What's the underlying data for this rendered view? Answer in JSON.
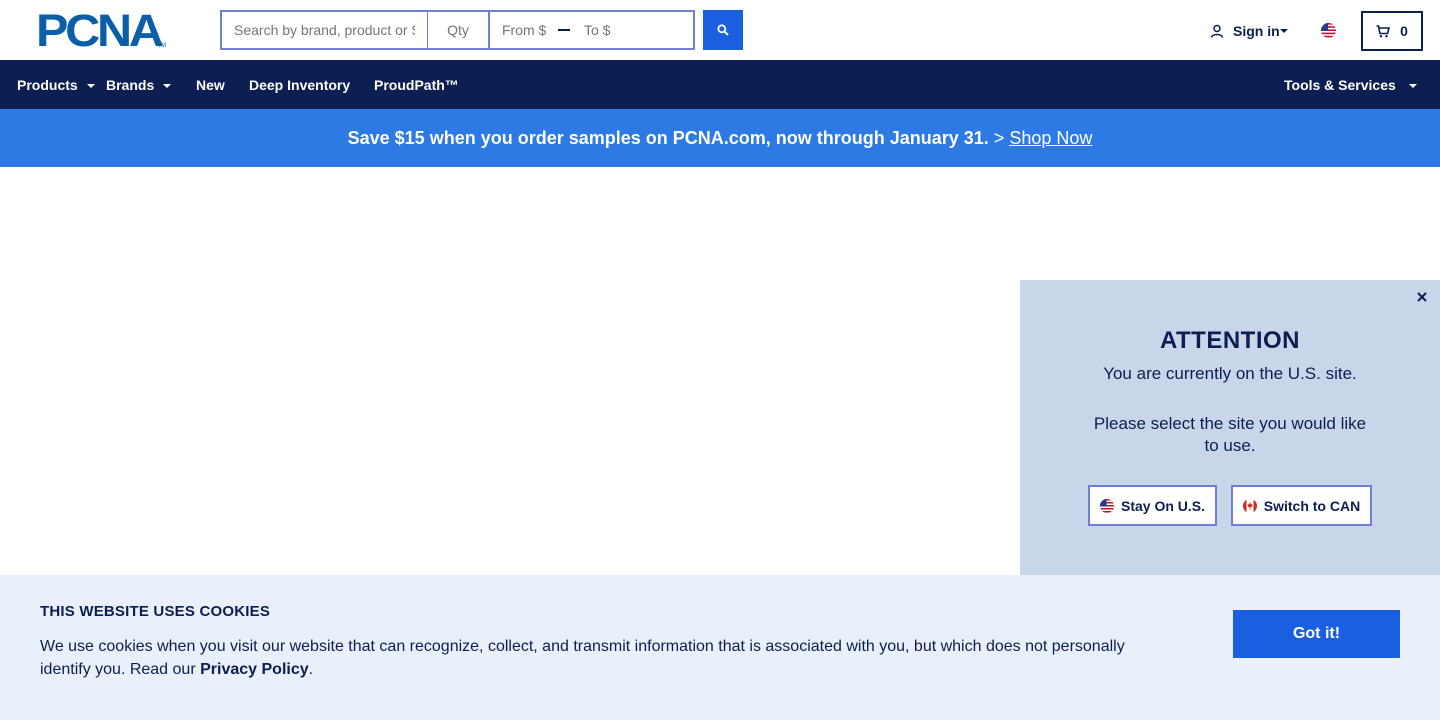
{
  "header": {
    "logo_text": "PCNA",
    "logo_tm": "TM",
    "search": {
      "placeholder": "Search by brand, product or SKU",
      "qty_placeholder": "Qty",
      "from_placeholder": "From $",
      "to_placeholder": "To $",
      "search_icon": "magnifier-icon"
    },
    "signin_label": "Sign in",
    "signin_icon": "user-icon",
    "locale_flag": "us-flag-icon",
    "cart_icon": "cart-icon",
    "cart_count": "0"
  },
  "nav": {
    "items": [
      {
        "label": "Products",
        "has_dropdown": true
      },
      {
        "label": "Brands",
        "has_dropdown": true
      },
      {
        "label": "New",
        "has_dropdown": false
      },
      {
        "label": "Deep Inventory",
        "has_dropdown": false
      },
      {
        "label": "ProudPath™",
        "has_dropdown": false
      }
    ],
    "right_item": {
      "label": "Tools & Services",
      "has_dropdown": true
    }
  },
  "promo": {
    "text": "Save $15 when you order samples on PCNA.com, now through January 31.",
    "separator": ">",
    "link": "Shop Now"
  },
  "attention": {
    "title": "ATTENTION",
    "line1": "You are currently on the U.S. site.",
    "line2": "Please select the site you would like to use.",
    "stay_label": "Stay On U.S.",
    "switch_label": "Switch to CAN",
    "close_icon": "close-icon"
  },
  "cookie": {
    "title": "THIS WEBSITE USES COOKIES",
    "text": "We use cookies when you visit our website that can recognize, collect, and transmit information that is associated with you, but which does not personally identify you. Read our",
    "link": "Privacy Policy",
    "end": ".",
    "button": "Got it!"
  },
  "colors": {
    "nav_bg": "#0c1e52",
    "promo_bg": "#2d7ae4",
    "primary_button": "#1a5fe0",
    "attention_bg": "#c9d6ea",
    "cookie_bg": "#e9f0fa",
    "logo": "#0a5fa8"
  }
}
